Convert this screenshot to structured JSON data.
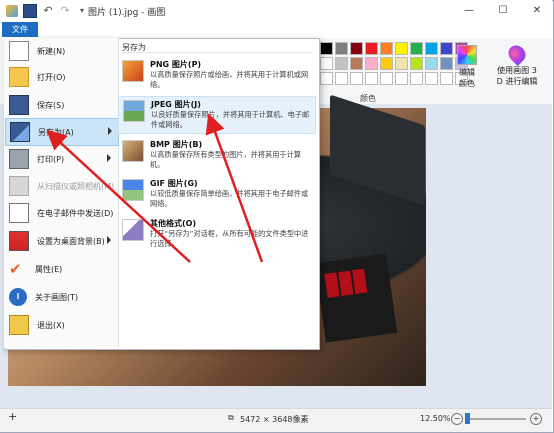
{
  "window": {
    "title": "图片 (1).jpg - 画图"
  },
  "ribbon": {
    "file_tab": "文件",
    "colors_label": "颜色",
    "edit_colors": "编辑\n颜色",
    "paint3d": "使用画图 3\nD 进行编辑",
    "palette": [
      "#000000",
      "#7f7f7f",
      "#880015",
      "#ed1c24",
      "#ff7f27",
      "#fff200",
      "#22b14c",
      "#00a2e8",
      "#3f48cc",
      "#a349a4",
      "#ffffff",
      "#c3c3c3",
      "#b97a57",
      "#ffaec9",
      "#ffc90e",
      "#efe4b0",
      "#b5e61d",
      "#99d9ea",
      "#7092be",
      "#c8bfe7",
      "#ffffff",
      "#ffffff",
      "#ffffff",
      "#ffffff",
      "#ffffff",
      "#ffffff",
      "#ffffff",
      "#ffffff",
      "#ffffff",
      "#ffffff"
    ]
  },
  "file_menu": {
    "items": [
      {
        "label": "新建(N)",
        "icon": "new-file-icon"
      },
      {
        "label": "打开(O)",
        "icon": "open-folder-icon"
      },
      {
        "label": "保存(S)",
        "icon": "save-icon"
      },
      {
        "label": "另存为(A)",
        "icon": "save-as-icon",
        "selected": true,
        "submenu": true
      },
      {
        "label": "打印(P)",
        "icon": "printer-icon",
        "submenu": true
      },
      {
        "label": "从扫描仪或照相机(M)",
        "icon": "scanner-icon",
        "disabled": true
      },
      {
        "label": "在电子邮件中发送(D)",
        "icon": "email-icon"
      },
      {
        "label": "设置为桌面背景(B)",
        "icon": "desktop-icon",
        "submenu": true
      },
      {
        "label": "属性(E)",
        "icon": "checkmark-icon"
      },
      {
        "label": "关于画图(T)",
        "icon": "info-icon"
      },
      {
        "label": "退出(X)",
        "icon": "exit-icon"
      }
    ]
  },
  "save_as_menu": {
    "heading": "另存为",
    "options": [
      {
        "title": "PNG 图片(P)",
        "desc": "以高质量保存照片或绘画，并将其用于计算机或网络。",
        "icon": "png-icon"
      },
      {
        "title": "JPEG 图片(J)",
        "desc": "以良好质量保存照片，并将其用于计算机、电子邮件或网络。",
        "icon": "jpeg-icon",
        "highlighted": true
      },
      {
        "title": "BMP 图片(B)",
        "desc": "以高质量保存所有类型的图片，并将其用于计算机。",
        "icon": "bmp-icon"
      },
      {
        "title": "GIF 图片(G)",
        "desc": "以较低质量保存简单绘画，并将其用于电子邮件或网络。",
        "icon": "gif-icon"
      },
      {
        "title": "其他格式(O)",
        "desc": "打开“另存为”对话框，从所有可能的文件类型中进行选择。",
        "icon": "other-format-icon"
      }
    ]
  },
  "status": {
    "dimensions": "5472 × 3648像素",
    "zoom": "12.50%"
  }
}
